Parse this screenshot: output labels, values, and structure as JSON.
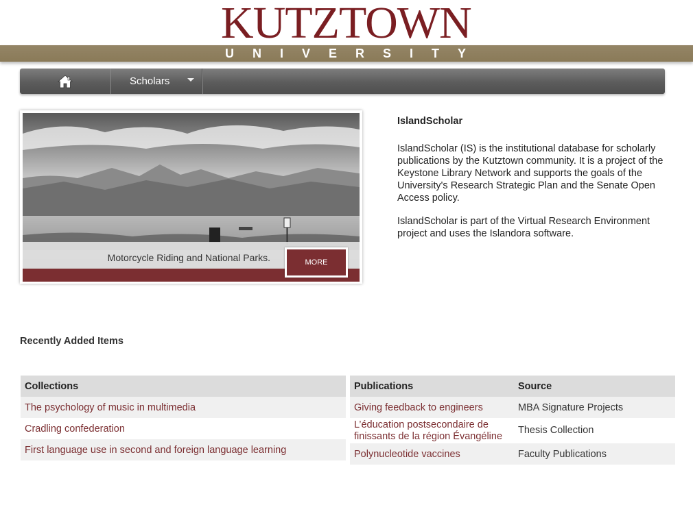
{
  "brand": {
    "logo_main": "KUTZTOWN",
    "logo_sub": "UNIVERSITY"
  },
  "nav": {
    "home_icon": "home-icon",
    "scholars_label": "Scholars"
  },
  "slide": {
    "caption": "Motorcycle Riding and National Parks.",
    "more_label": "MORE"
  },
  "intro": {
    "title": "IslandScholar",
    "p1": "IslandScholar (IS) is the institutional database for scholarly publications by the Kutztown community. It is a project of the Keystone Library Network and supports the goals of the University's Research Strategic Plan and the Senate Open Access policy.",
    "p2": "IslandScholar is part of the Virtual Research Environment project and uses the Islandora software."
  },
  "recent": {
    "title": "Recently Added Items",
    "collections_header": "Collections",
    "collections": [
      "The psychology of music in multimedia",
      "Cradling confederation",
      "First language use in second and foreign language learning"
    ],
    "publications_header": "Publications",
    "source_header": "Source",
    "publications": [
      {
        "title": "Giving feedback to engineers",
        "source": "MBA Signature Projects"
      },
      {
        "title": "L’éducation postsecondaire de finissants de la région Évangéline",
        "source": "Thesis Collection"
      },
      {
        "title": "Polynucleotide vaccines",
        "source": "Faculty Publications"
      }
    ]
  },
  "colors": {
    "brand_red": "#7b2e31",
    "gold": "#948566",
    "nav_gray": "#5c5c5c"
  }
}
